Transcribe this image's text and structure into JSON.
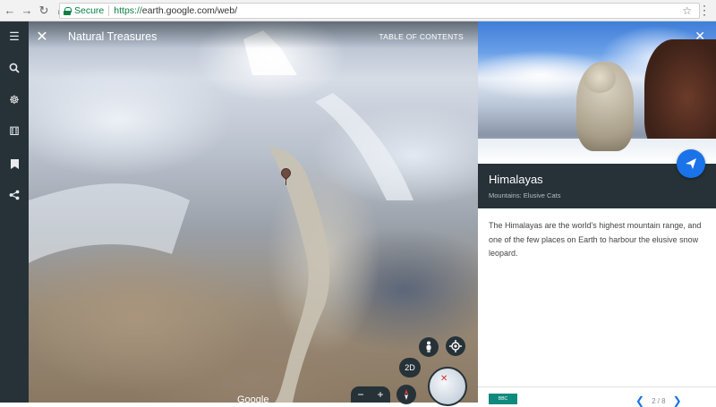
{
  "browser": {
    "secure_label": "Secure",
    "url_scheme": "https://",
    "url_rest": "earth.google.com/web/"
  },
  "rail": {
    "items": [
      "menu-icon",
      "search-icon",
      "voyager-icon",
      "dice-icon",
      "bookmark-icon",
      "share-icon"
    ]
  },
  "map": {
    "title": "Natural Treasures",
    "toc_label": "TABLE OF CONTENTS",
    "btn_2d": "2D",
    "zoom_out": "−",
    "zoom_in": "+",
    "attribution": "Google"
  },
  "panel": {
    "place_title": "Himalayas",
    "place_subtitle": "Mountains: Elusive Cats",
    "description": "The Himalayas are the world's highest mountain range, and one of the few places on Earth to harbour the elusive snow leopard.",
    "source_badge": "BBC",
    "page_indicator": "2 / 8"
  },
  "colors": {
    "rail_bg": "#263238",
    "accent": "#1a73e8",
    "secure_green": "#0b8043"
  }
}
